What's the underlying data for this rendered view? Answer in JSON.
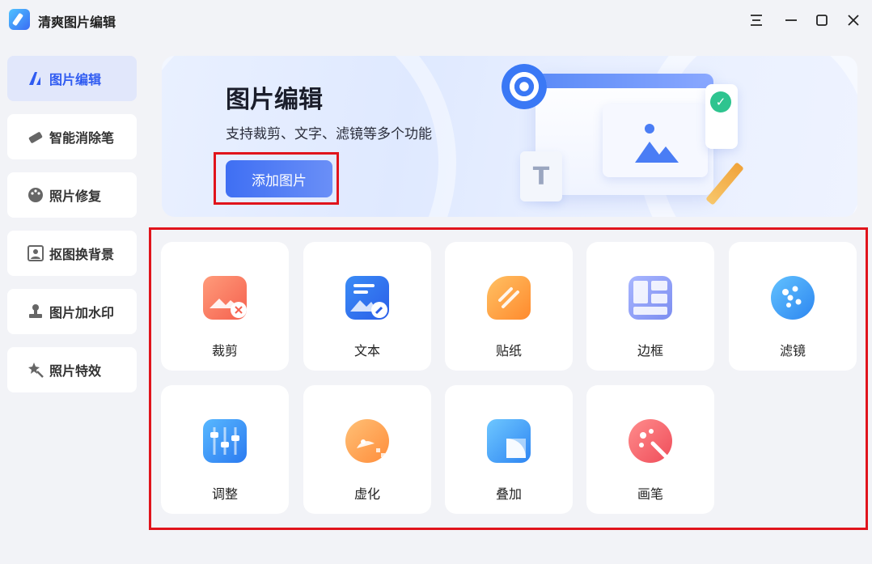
{
  "app": {
    "title": "清爽图片编辑"
  },
  "window_controls": [
    "menu-icon",
    "minimize-icon",
    "maximize-icon",
    "close-icon"
  ],
  "sidebar": {
    "items": [
      {
        "label": "图片编辑",
        "icon": "image-edit-icon",
        "active": true
      },
      {
        "label": "智能消除笔",
        "icon": "eraser-icon",
        "active": false
      },
      {
        "label": "照片修复",
        "icon": "palette-icon",
        "active": false
      },
      {
        "label": "抠图换背景",
        "icon": "portrait-icon",
        "active": false
      },
      {
        "label": "图片加水印",
        "icon": "stamp-icon",
        "active": false
      },
      {
        "label": "照片特效",
        "icon": "magic-icon",
        "active": false
      }
    ]
  },
  "banner": {
    "title": "图片编辑",
    "subtitle": "支持裁剪、文字、滤镜等多个功能",
    "add_button": "添加图片"
  },
  "tools": [
    {
      "label": "裁剪",
      "icon": "crop-icon"
    },
    {
      "label": "文本",
      "icon": "text-icon"
    },
    {
      "label": "贴纸",
      "icon": "sticker-icon"
    },
    {
      "label": "边框",
      "icon": "border-icon"
    },
    {
      "label": "滤镜",
      "icon": "filter-icon"
    },
    {
      "label": "调整",
      "icon": "adjust-icon"
    },
    {
      "label": "虚化",
      "icon": "blur-icon"
    },
    {
      "label": "叠加",
      "icon": "overlay-icon"
    },
    {
      "label": "画笔",
      "icon": "brush-icon"
    }
  ],
  "colors": {
    "accent": "#2f5bf1",
    "highlight": "#e0141c",
    "background": "#f2f3f7"
  }
}
